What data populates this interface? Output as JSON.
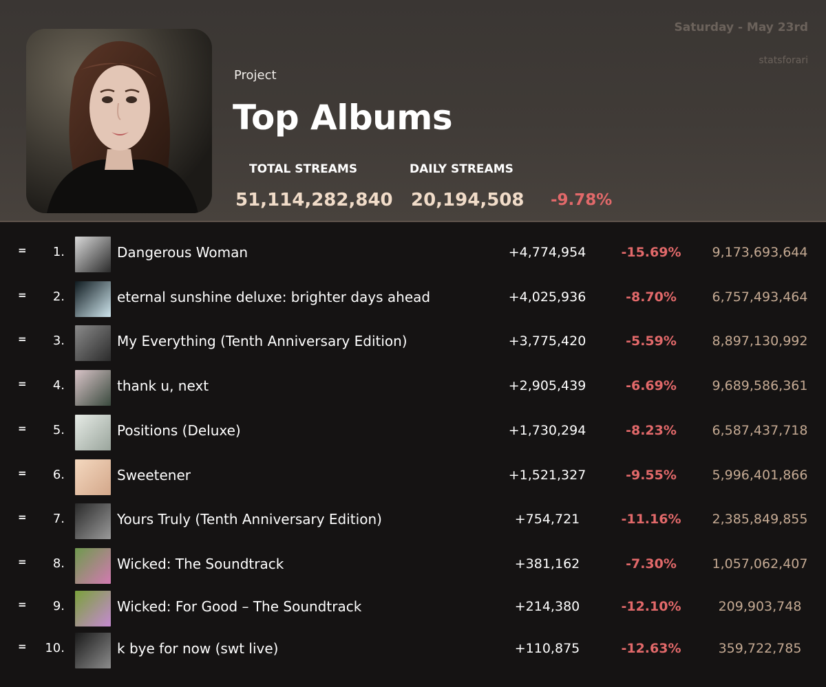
{
  "header": {
    "eyebrow": "Project",
    "title": "Top Albums",
    "date": "Saturday - May 23rd",
    "handle": "statsforari",
    "total_streams_label": "TOTAL STREAMS",
    "total_streams_value": "51,114,282,840",
    "daily_streams_label": "DAILY STREAMS",
    "daily_streams_value": "20,194,508",
    "daily_change": "-9.78%"
  },
  "colors": {
    "header_bg": "#403b37",
    "body_bg": "#151313",
    "negative": "#e2696a",
    "total_text": "#c5aa93",
    "stat_value": "#f1dcc9",
    "date_text": "#6b625b"
  },
  "albums": [
    {
      "move": "=",
      "rank": "1.",
      "name": "Dangerous Woman",
      "daily": "+4,774,954",
      "change": "-15.69%",
      "total": "9,173,693,644",
      "art_icon": "dangerous-woman-cover",
      "art_colors": [
        "#d9d9d9",
        "#2a2a2a"
      ]
    },
    {
      "move": "=",
      "rank": "2.",
      "name": "eternal sunshine deluxe: brighter days ahead",
      "daily": "+4,025,936",
      "change": "-8.70%",
      "total": "6,757,493,464",
      "art_icon": "eternal-sunshine-cover",
      "art_colors": [
        "#0f1a1f",
        "#cfe6ee"
      ]
    },
    {
      "move": "=",
      "rank": "3.",
      "name": "My Everything (Tenth Anniversary Edition)",
      "daily": "+3,775,420",
      "change": "-5.59%",
      "total": "8,897,130,992",
      "art_icon": "my-everything-cover",
      "art_colors": [
        "#8a8a8a",
        "#2b2b2b"
      ]
    },
    {
      "move": "=",
      "rank": "4.",
      "name": "thank u, next",
      "daily": "+2,905,439",
      "change": "-6.69%",
      "total": "9,689,586,361",
      "art_icon": "thank-u-next-cover",
      "art_colors": [
        "#d9c4c8",
        "#3a4a3e"
      ]
    },
    {
      "move": "=",
      "rank": "5.",
      "name": "Positions (Deluxe)",
      "daily": "+1,730,294",
      "change": "-8.23%",
      "total": "6,587,437,718",
      "art_icon": "positions-cover",
      "art_colors": [
        "#e6ebe6",
        "#9aa59c"
      ]
    },
    {
      "move": "=",
      "rank": "6.",
      "name": "Sweetener",
      "daily": "+1,521,327",
      "change": "-9.55%",
      "total": "5,996,401,866",
      "art_icon": "sweetener-cover",
      "art_colors": [
        "#f4d8bf",
        "#d3a78a"
      ]
    },
    {
      "move": "=",
      "rank": "7.",
      "name": "Yours Truly (Tenth Anniversary Edition)",
      "daily": "+754,721",
      "change": "-11.16%",
      "total": "2,385,849,855",
      "art_icon": "yours-truly-cover",
      "art_colors": [
        "#2a2a2a",
        "#9a9a9a"
      ]
    },
    {
      "move": "=",
      "rank": "8.",
      "name": "Wicked: The Soundtrack",
      "daily": "+381,162",
      "change": "-7.30%",
      "total": "1,057,062,407",
      "art_icon": "wicked-soundtrack-cover",
      "art_colors": [
        "#6f9a4e",
        "#d27ab1"
      ]
    },
    {
      "move": "=",
      "rank": "9.",
      "name": "Wicked: For Good – The Soundtrack",
      "daily": "+214,380",
      "change": "-12.10%",
      "total": "209,903,748",
      "art_icon": "wicked-for-good-cover",
      "art_colors": [
        "#7aa13b",
        "#c58ad1"
      ]
    },
    {
      "move": "=",
      "rank": "10.",
      "name": "k bye for now (swt live)",
      "daily": "+110,875",
      "change": "-12.63%",
      "total": "359,722,785",
      "art_icon": "k-bye-for-now-cover",
      "art_colors": [
        "#1a1a1a",
        "#8c8c8c"
      ]
    }
  ]
}
